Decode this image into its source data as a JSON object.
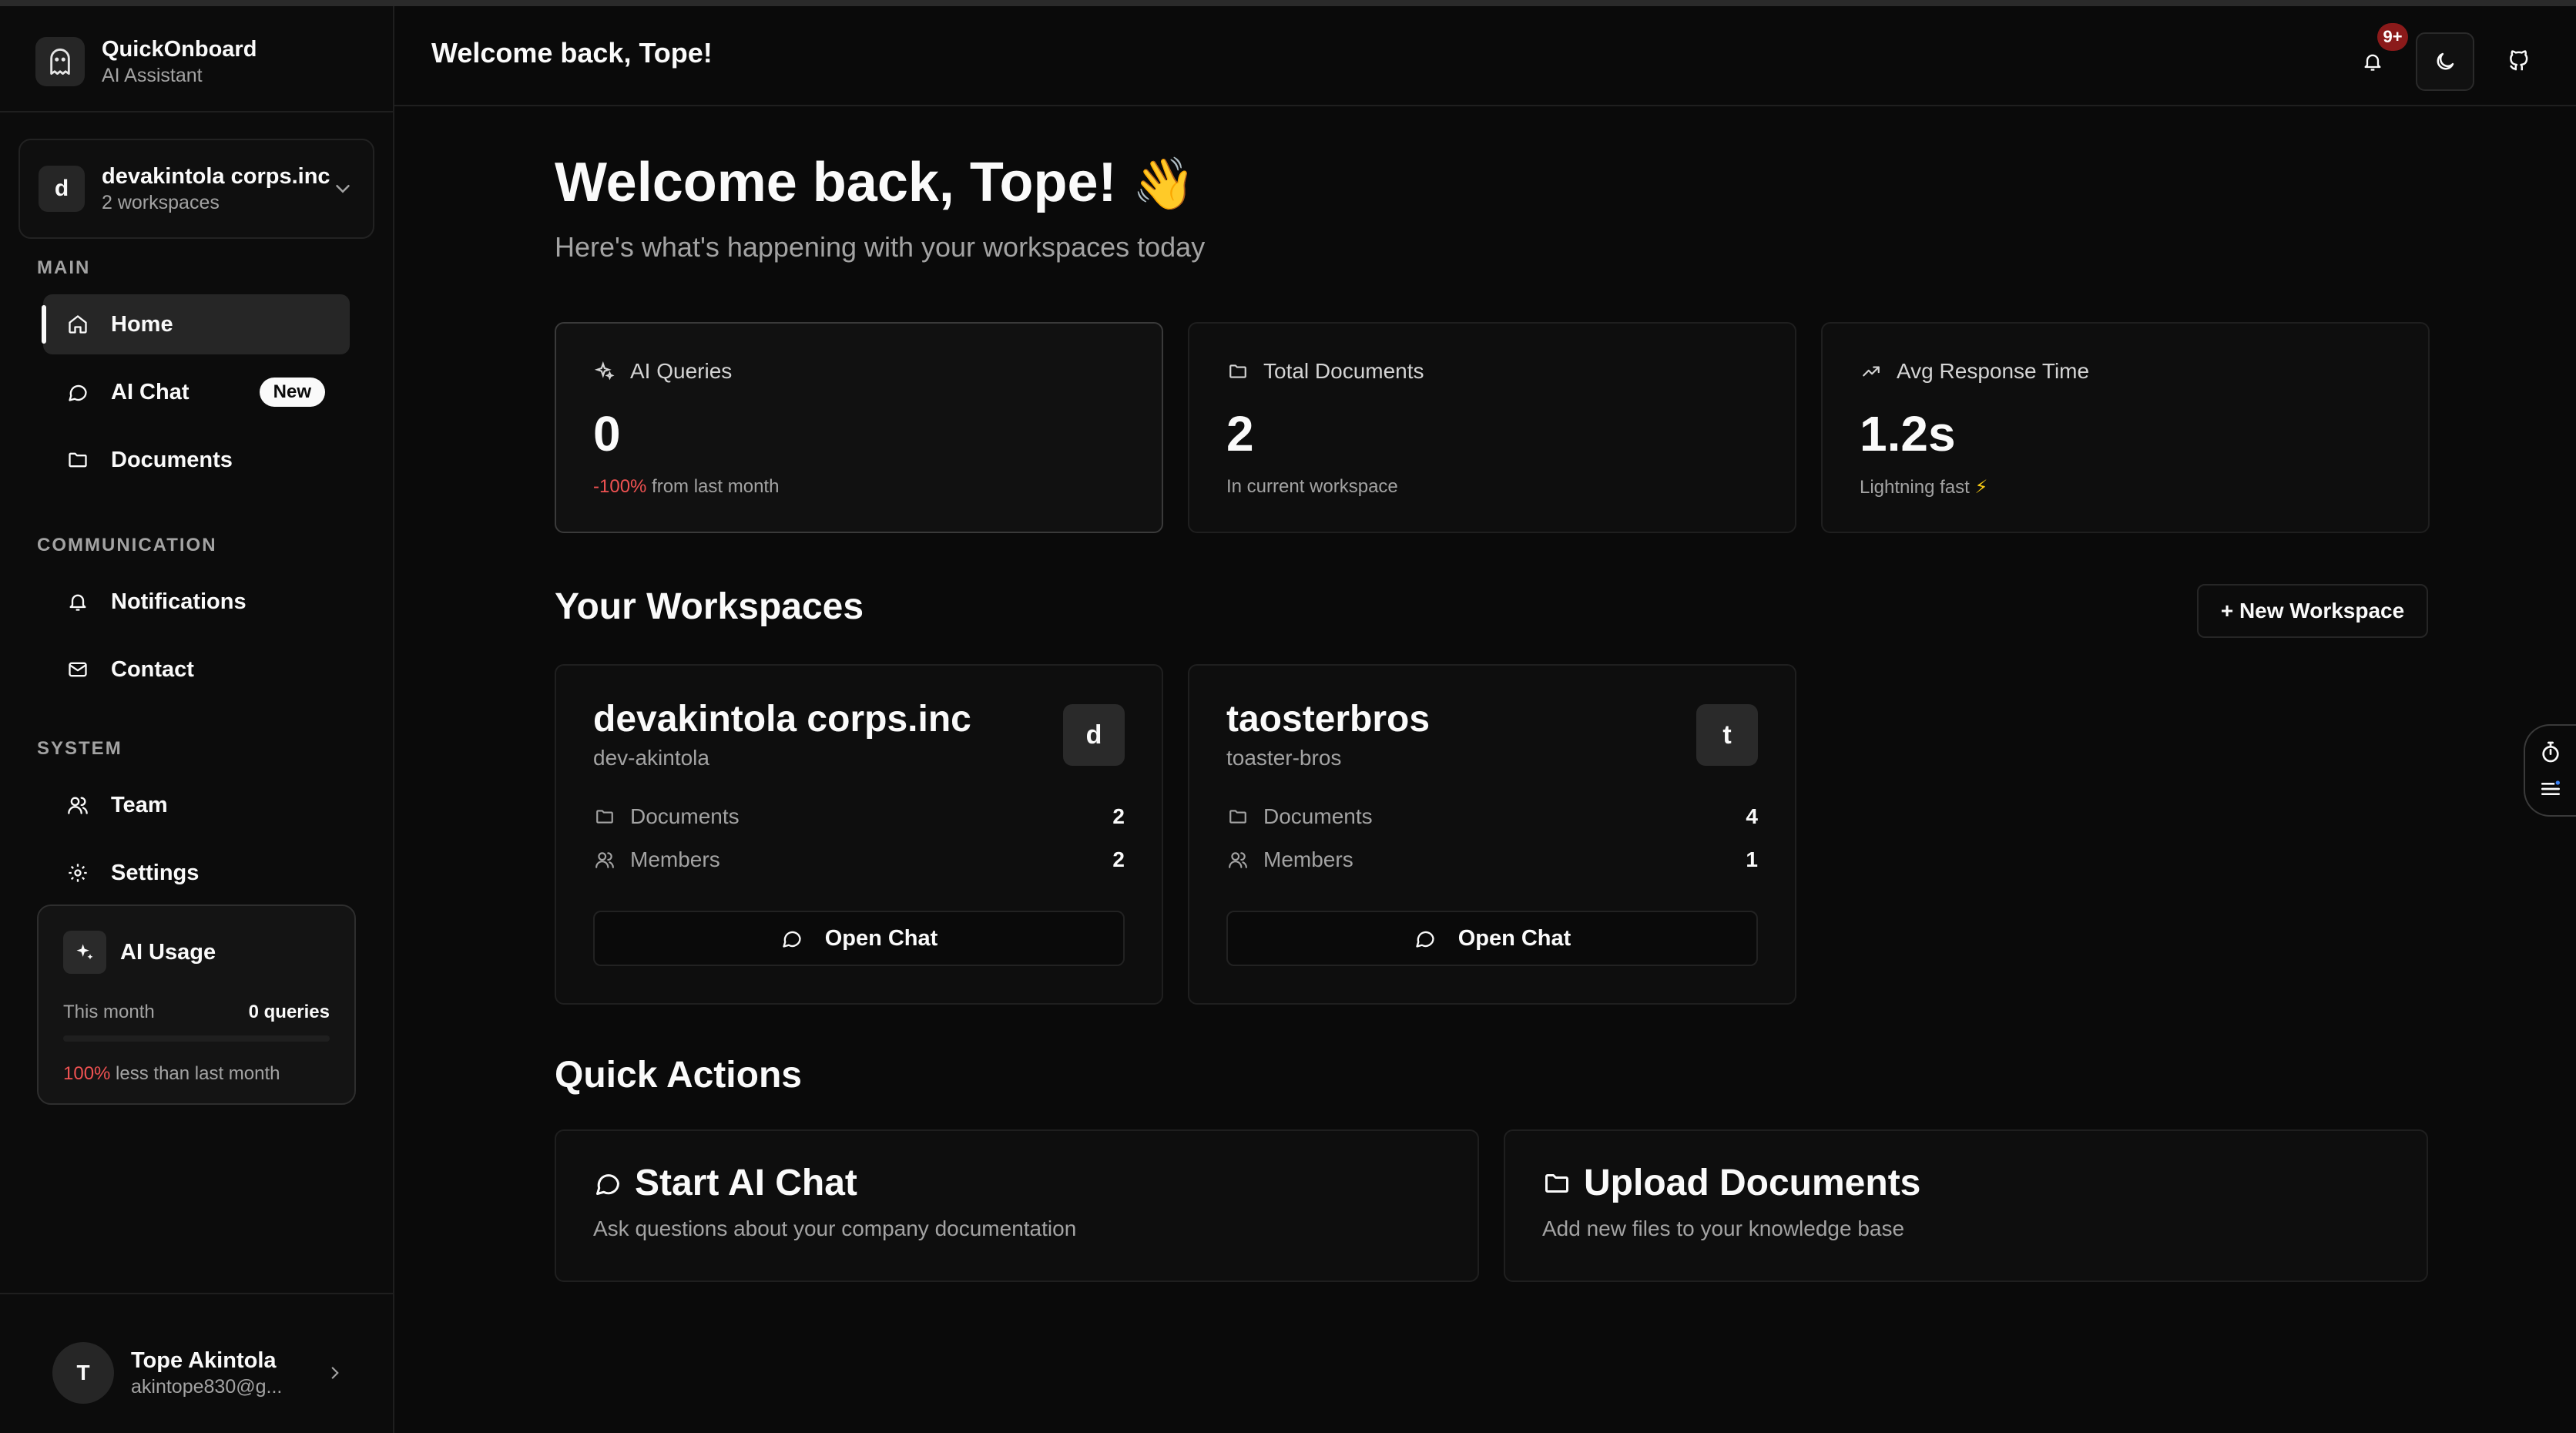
{
  "app": {
    "name": "QuickOnboard",
    "subtitle": "AI Assistant"
  },
  "workspace_switcher": {
    "initial": "d",
    "name": "devakintola corps.inc",
    "count": "2 workspaces"
  },
  "sidebar": {
    "sections": {
      "main": "MAIN",
      "communication": "COMMUNICATION",
      "system": "SYSTEM"
    },
    "items": {
      "home": "Home",
      "ai_chat": "AI Chat",
      "ai_chat_badge": "New",
      "documents": "Documents",
      "notifications": "Notifications",
      "contact": "Contact",
      "team": "Team",
      "settings": "Settings"
    }
  },
  "usage": {
    "title": "AI Usage",
    "period_label": "This month",
    "period_value": "0 queries",
    "progress": 0,
    "change_pct": "100%",
    "change_text": " less than last month"
  },
  "user": {
    "initial": "T",
    "name": "Tope Akintola",
    "email": "akintope830@g..."
  },
  "header": {
    "title": "Welcome back, Tope!",
    "notification_badge": "9+"
  },
  "main": {
    "title": "Welcome back, Tope!",
    "title_emoji": "👋",
    "subtitle": "Here's what's happening with your workspaces today"
  },
  "stats": [
    {
      "label": "AI Queries",
      "value": "0",
      "note_highlight": "-100%",
      "note": " from last month"
    },
    {
      "label": "Total Documents",
      "value": "2",
      "note": "In current workspace"
    },
    {
      "label": "Avg Response Time",
      "value": "1.2s",
      "note": "Lightning fast ",
      "note_emoji": "⚡"
    }
  ],
  "workspaces_section": {
    "title": "Your Workspaces",
    "new_button": "+ New Workspace"
  },
  "workspaces": [
    {
      "name": "devakintola corps.inc",
      "slug": "dev-akintola",
      "initial": "d",
      "documents_label": "Documents",
      "documents": "2",
      "members_label": "Members",
      "members": "2",
      "action": "Open Chat"
    },
    {
      "name": "taosterbros",
      "slug": "toaster-bros",
      "initial": "t",
      "documents_label": "Documents",
      "documents": "4",
      "members_label": "Members",
      "members": "1",
      "action": "Open Chat"
    }
  ],
  "quick_actions": {
    "title": "Quick Actions",
    "items": [
      {
        "title": "Start AI Chat",
        "desc": "Ask questions about your company documentation"
      },
      {
        "title": "Upload Documents",
        "desc": "Add new files to your knowledge base"
      }
    ]
  },
  "colors": {
    "accent_red": "#f05252",
    "badge_bg": "#8b1a1a",
    "background": "#0a0a0a"
  }
}
